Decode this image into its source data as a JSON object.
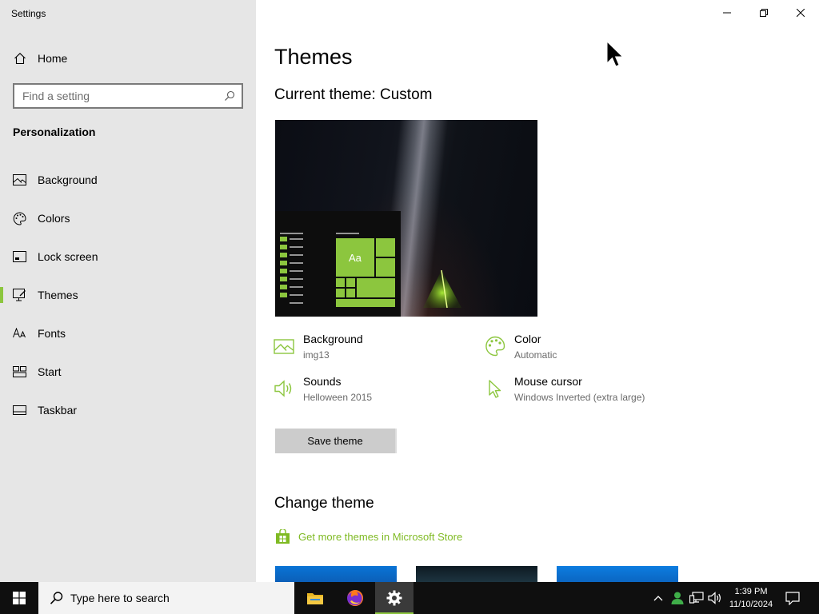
{
  "window": {
    "title": "Settings"
  },
  "sidebar": {
    "home_label": "Home",
    "search_placeholder": "Find a setting",
    "section_title": "Personalization",
    "items": [
      {
        "label": "Background",
        "icon": "image-icon"
      },
      {
        "label": "Colors",
        "icon": "palette-icon"
      },
      {
        "label": "Lock screen",
        "icon": "lock-screen-icon"
      },
      {
        "label": "Themes",
        "icon": "themes-icon",
        "active": true
      },
      {
        "label": "Fonts",
        "icon": "fonts-icon"
      },
      {
        "label": "Start",
        "icon": "start-icon"
      },
      {
        "label": "Taskbar",
        "icon": "taskbar-icon"
      }
    ]
  },
  "main": {
    "title": "Themes",
    "current_theme": "Current theme: Custom",
    "preview_tile_text": "Aa",
    "properties": {
      "background": {
        "name": "Background",
        "value": "img13"
      },
      "color": {
        "name": "Color",
        "value": "Automatic"
      },
      "sounds": {
        "name": "Sounds",
        "value": "Helloween 2015"
      },
      "mouse_cursor": {
        "name": "Mouse cursor",
        "value": "Windows Inverted (extra large)"
      }
    },
    "save_button": "Save theme",
    "change_theme_title": "Change theme",
    "store_link": "Get more themes in Microsoft Store"
  },
  "taskbar": {
    "search_placeholder": "Type here to search",
    "time": "1:39 PM",
    "date": "11/10/2024"
  },
  "colors": {
    "accent": "#8cc63e",
    "link": "#7fba23",
    "sidebar_bg": "#e6e6e6",
    "taskbar_bg": "#0f0f0f"
  }
}
